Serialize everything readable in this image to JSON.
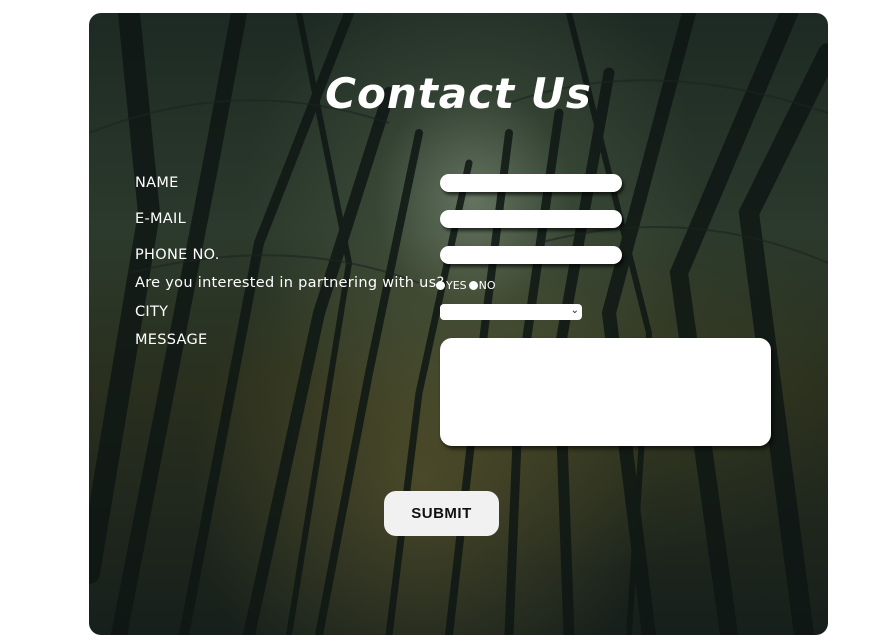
{
  "form": {
    "title": "Contact Us",
    "fields": {
      "name_label": "NAME",
      "email_label": "E-MAIL",
      "phone_label": "PHONE NO.",
      "partner_question": "Are you interested in partnering with us?",
      "partner_yes": "YES",
      "partner_no": "NO",
      "city_label": "CITY",
      "message_label": "MESSAGE"
    },
    "submit_label": "SUBMIT"
  },
  "colors": {
    "text": "#ffffff",
    "input_bg": "#ffffff",
    "button_bg": "#f1f1f1"
  }
}
